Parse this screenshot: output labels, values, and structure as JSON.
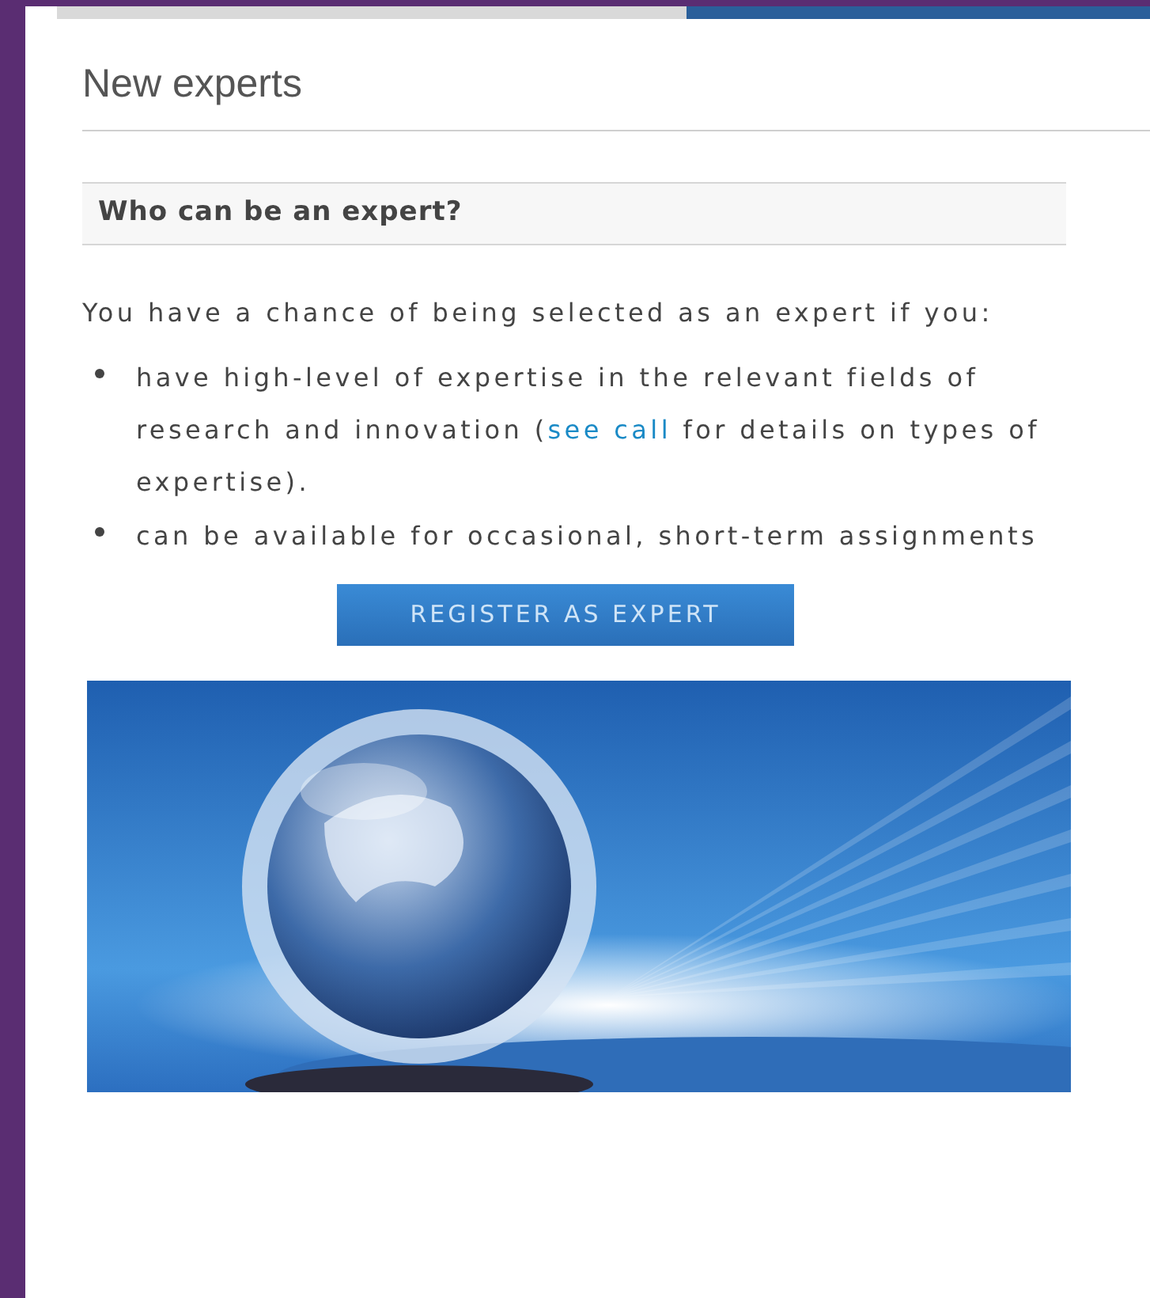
{
  "page_title": "New experts",
  "section": {
    "heading": "Who can be an expert?",
    "intro": "You have a chance of being selected as an expert if you:",
    "criteria": [
      {
        "text_before": "have high-level of expertise in the relevant fields of research and innovation (",
        "link": "see call",
        "text_after": " for details on types of expertise)."
      },
      {
        "text_before": "can be available for occasional, short-term assignments"
      }
    ],
    "button": "REGISTER AS EXPERT"
  }
}
